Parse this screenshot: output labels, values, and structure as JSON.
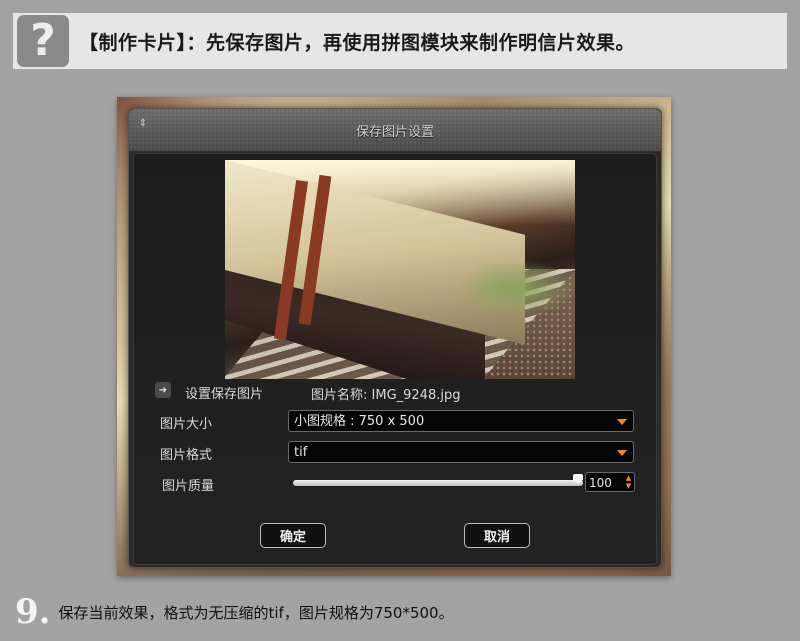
{
  "banner": {
    "help_icon_glyph": "?",
    "text": "【制作卡片】：先保存图片，再使用拼图模块来制作明信片效果。"
  },
  "dialog": {
    "title": "保存图片设置",
    "grip_glyph": "⇕",
    "section_label": "设置保存图片",
    "arrow_glyph": "➜",
    "file_name": "图片名称: IMG_9248.jpg",
    "size_label": "图片大小",
    "size_value": "小图规格 : 750 x 500",
    "format_label": "图片格式",
    "format_value": "tif",
    "quality_label": "图片质量",
    "quality_value": "100",
    "quality_fraction": 1.0,
    "spin_up": "▲",
    "spin_down": "▼",
    "ok_label": "确定",
    "cancel_label": "取消"
  },
  "caption": {
    "step": "9.",
    "text": "保存当前效果，格式为无压缩的tif，图片规格为750*500。"
  },
  "colors": {
    "accent": "#f08a1c",
    "background": "#a3a3a3",
    "dialog": "#2a2a2a"
  }
}
